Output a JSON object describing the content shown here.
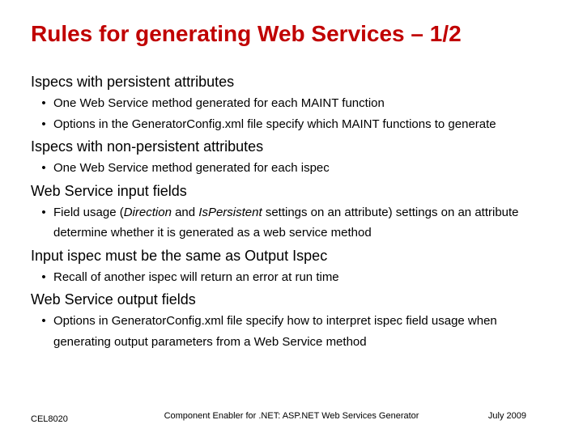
{
  "title": "Rules for generating Web Services – 1/2",
  "sections": {
    "s1": {
      "heading": "Ispecs with persistent attributes",
      "b1": "One Web Service method generated for each MAINT function",
      "b2": "Options in the GeneratorConfig.xml file specify which MAINT functions to generate"
    },
    "s2": {
      "heading": "Ispecs with non-persistent attributes",
      "b1": "One Web Service method generated for each ispec"
    },
    "s3": {
      "heading": "Web Service input fields",
      "b1_pre": "Field usage (",
      "b1_i1": "Direction",
      "b1_mid": " and ",
      "b1_i2": "IsPersistent",
      "b1_post": " settings on an attribute) settings on an attribute determine whether it is generated as a web service method"
    },
    "s4": {
      "heading": "Input ispec must be the same as Output Ispec",
      "b1": "Recall of another ispec will return an error at run time"
    },
    "s5": {
      "heading": "Web Service output fields",
      "b1": "Options in GeneratorConfig.xml file specify how to interpret ispec field usage when generating output parameters from a Web Service method"
    }
  },
  "footer": {
    "left": "CEL8020",
    "center": "Component Enabler for .NET: ASP.NET Web Services Generator",
    "right": "July 2009"
  }
}
